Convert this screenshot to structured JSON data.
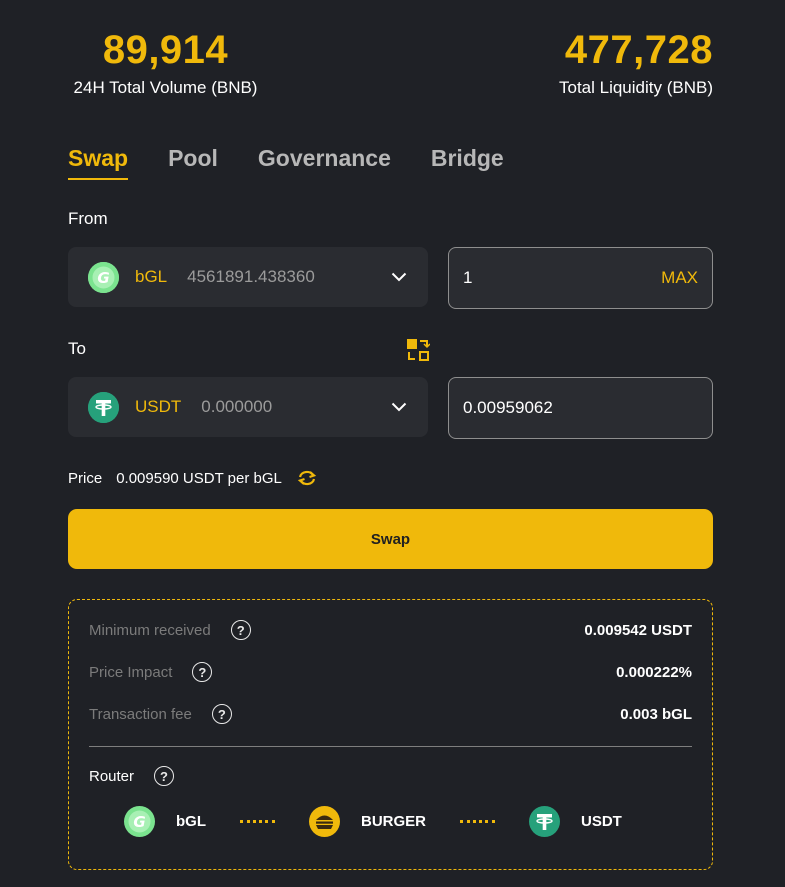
{
  "stats": {
    "volume_value": "89,914",
    "volume_label": "24H Total Volume (BNB)",
    "liquidity_value": "477,728",
    "liquidity_label": "Total Liquidity (BNB)"
  },
  "tabs": [
    {
      "label": "Swap",
      "active": true
    },
    {
      "label": "Pool",
      "active": false
    },
    {
      "label": "Governance",
      "active": false
    },
    {
      "label": "Bridge",
      "active": false
    }
  ],
  "from": {
    "label": "From",
    "token": "bGL",
    "balance": "4561891.438360",
    "amount": "1",
    "max_label": "MAX"
  },
  "to": {
    "label": "To",
    "token": "USDT",
    "balance": "0.000000",
    "amount": "0.00959062"
  },
  "price": {
    "label": "Price",
    "value": "0.009590 USDT per bGL"
  },
  "swap_button": "Swap",
  "details": {
    "minimum_received_label": "Minimum received",
    "minimum_received_value": "0.009542 USDT",
    "price_impact_label": "Price Impact",
    "price_impact_value": "0.000222%",
    "fee_label": "Transaction fee",
    "fee_value": "0.003 bGL",
    "router_label": "Router",
    "route": [
      "bGL",
      "BURGER",
      "USDT"
    ]
  },
  "icons": {
    "bgl": "bgl-token-icon",
    "usdt": "usdt-token-icon",
    "burger": "burger-token-icon",
    "switch": "swap-direction-icon",
    "refresh": "refresh-icon",
    "help": "question-icon",
    "chevron": "chevron-down-icon"
  },
  "colors": {
    "accent": "#f0b90b",
    "background": "#1f2126",
    "panel": "#2a2c31",
    "bgl_green": "#7be38f",
    "usdt_teal": "#26a17b"
  }
}
